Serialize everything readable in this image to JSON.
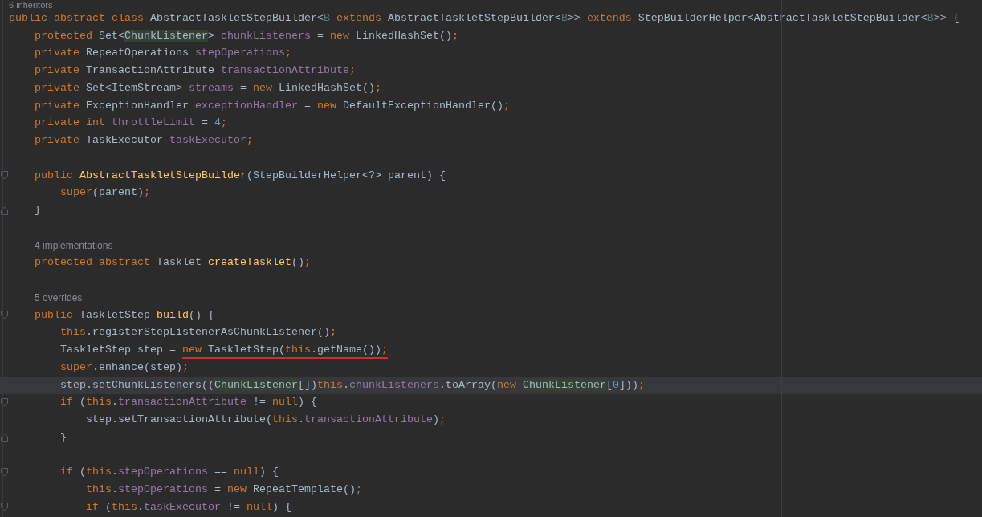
{
  "editor": {
    "lines": [
      {
        "kind": "hint",
        "text": "6 inheritors"
      },
      {
        "kind": "code",
        "tokens": [
          {
            "kind": "keyword",
            "text": "public abstract class "
          },
          {
            "kind": "plain",
            "text": "AbstractTaskletStepBuilder<"
          },
          {
            "kind": "type_param",
            "text": "B"
          },
          {
            "kind": "keyword",
            "text": " extends"
          },
          {
            "kind": "plain",
            "text": " AbstractTaskletStepBuilder<"
          },
          {
            "kind": "type_param",
            "text": "B"
          },
          {
            "kind": "plain",
            "text": ">> "
          },
          {
            "kind": "keyword",
            "text": "extends"
          },
          {
            "kind": "plain",
            "text": " StepBuilderHelper<AbstractTaskletStepBuilder<"
          },
          {
            "kind": "type_param",
            "text": "B"
          },
          {
            "kind": "plain",
            "text": ">> {"
          }
        ],
        "children": [
          {
            "kind": "code",
            "tokens": [
              {
                "kind": "keyword",
                "text": "protected "
              },
              {
                "kind": "plain",
                "text": "Set<"
              },
              {
                "kind": "usage",
                "text": "ChunkListener"
              },
              {
                "kind": "plain",
                "text": "> "
              },
              {
                "kind": "field",
                "text": "chunkListeners"
              },
              {
                "kind": "plain",
                "text": " = "
              },
              {
                "kind": "keyword",
                "text": "new "
              },
              {
                "kind": "plain",
                "text": "LinkedHashSet()"
              },
              {
                "kind": "keyword",
                "text": ";"
              }
            ]
          },
          {
            "kind": "code",
            "tokens": [
              {
                "kind": "keyword",
                "text": "private "
              },
              {
                "kind": "plain",
                "text": "RepeatOperations "
              },
              {
                "kind": "field",
                "text": "stepOperations"
              },
              {
                "kind": "keyword",
                "text": ";"
              }
            ]
          },
          {
            "kind": "code",
            "tokens": [
              {
                "kind": "keyword",
                "text": "private "
              },
              {
                "kind": "plain",
                "text": "TransactionAttribute "
              },
              {
                "kind": "field",
                "text": "transactionAttribute"
              },
              {
                "kind": "keyword",
                "text": ";"
              }
            ]
          },
          {
            "kind": "code",
            "tokens": [
              {
                "kind": "keyword",
                "text": "private "
              },
              {
                "kind": "plain",
                "text": "Set<ItemStream> "
              },
              {
                "kind": "field",
                "text": "streams"
              },
              {
                "kind": "plain",
                "text": " = "
              },
              {
                "kind": "keyword",
                "text": "new "
              },
              {
                "kind": "plain",
                "text": "LinkedHashSet()"
              },
              {
                "kind": "keyword",
                "text": ";"
              }
            ]
          },
          {
            "kind": "code",
            "tokens": [
              {
                "kind": "keyword",
                "text": "private "
              },
              {
                "kind": "plain",
                "text": "ExceptionHandler "
              },
              {
                "kind": "field",
                "text": "exceptionHandler"
              },
              {
                "kind": "plain",
                "text": " = "
              },
              {
                "kind": "keyword",
                "text": "new "
              },
              {
                "kind": "plain",
                "text": "DefaultExceptionHandler()"
              },
              {
                "kind": "keyword",
                "text": ";"
              }
            ]
          },
          {
            "kind": "code",
            "tokens": [
              {
                "kind": "keyword",
                "text": "private int "
              },
              {
                "kind": "field",
                "text": "throttleLimit"
              },
              {
                "kind": "plain",
                "text": " = "
              },
              {
                "kind": "number",
                "text": "4"
              },
              {
                "kind": "keyword",
                "text": ";"
              }
            ]
          },
          {
            "kind": "code",
            "tokens": [
              {
                "kind": "keyword",
                "text": "private "
              },
              {
                "kind": "plain",
                "text": "TaskExecutor "
              },
              {
                "kind": "field",
                "text": "taskExecutor"
              },
              {
                "kind": "keyword",
                "text": ";"
              }
            ]
          },
          {
            "kind": "blank"
          },
          {
            "kind": "code",
            "expanded": true,
            "tokens": [
              {
                "kind": "keyword",
                "text": "public "
              },
              {
                "kind": "declaration",
                "text": "AbstractTaskletStepBuilder"
              },
              {
                "kind": "plain",
                "text": "(StepBuilderHelper<?> parent) {"
              }
            ],
            "children": [
              {
                "kind": "code",
                "tokens": [
                  {
                    "kind": "keyword",
                    "text": "super"
                  },
                  {
                    "kind": "plain",
                    "text": "(parent)"
                  },
                  {
                    "kind": "keyword",
                    "text": ";"
                  }
                ]
              }
            ]
          },
          {
            "kind": "code",
            "block_end": true,
            "tokens": [
              {
                "kind": "plain",
                "text": "}"
              }
            ]
          },
          {
            "kind": "blank"
          },
          {
            "kind": "hint",
            "text": "4 implementations"
          },
          {
            "kind": "code",
            "tokens": [
              {
                "kind": "keyword",
                "text": "protected abstract "
              },
              {
                "kind": "plain",
                "text": "Tasklet "
              },
              {
                "kind": "declaration",
                "text": "createTasklet"
              },
              {
                "kind": "plain",
                "text": "()"
              },
              {
                "kind": "keyword",
                "text": ";"
              }
            ]
          },
          {
            "kind": "blank"
          },
          {
            "kind": "hint",
            "text": "5 overrides"
          },
          {
            "kind": "code",
            "expanded": true,
            "tokens": [
              {
                "kind": "keyword",
                "text": "public "
              },
              {
                "kind": "plain",
                "text": "TaskletStep "
              },
              {
                "kind": "declaration",
                "text": "build"
              },
              {
                "kind": "plain",
                "text": "() {"
              }
            ],
            "children": [
              {
                "kind": "code",
                "tokens": [
                  {
                    "kind": "keyword",
                    "text": "this"
                  },
                  {
                    "kind": "plain",
                    "text": ".registerStepListenerAsChunkListener()"
                  },
                  {
                    "kind": "keyword",
                    "text": ";"
                  }
                ]
              },
              {
                "kind": "code",
                "tokens": [
                  {
                    "kind": "plain",
                    "text": "TaskletStep step = "
                  }
                ],
                "underlined_tokens": [
                  {
                    "kind": "keyword",
                    "text": "new "
                  },
                  {
                    "kind": "plain",
                    "text": "TaskletStep("
                  },
                  {
                    "kind": "keyword",
                    "text": "this"
                  },
                  {
                    "kind": "plain",
                    "text": ".getName())"
                  },
                  {
                    "kind": "keyword",
                    "text": ";"
                  }
                ]
              },
              {
                "kind": "code",
                "tokens": [
                  {
                    "kind": "keyword",
                    "text": "super"
                  },
                  {
                    "kind": "plain",
                    "text": ".enhance(step)"
                  },
                  {
                    "kind": "keyword",
                    "text": ";"
                  }
                ]
              },
              {
                "kind": "code",
                "current": true,
                "tokens": [
                  {
                    "kind": "plain",
                    "text": "step.setChunkListeners(("
                  },
                  {
                    "kind": "usage",
                    "text": "ChunkListener"
                  },
                  {
                    "kind": "plain",
                    "text": "[])"
                  },
                  {
                    "kind": "keyword",
                    "text": "this"
                  },
                  {
                    "kind": "plain",
                    "text": "."
                  },
                  {
                    "kind": "field",
                    "text": "chunkListeners"
                  },
                  {
                    "kind": "plain",
                    "text": ".toArray("
                  },
                  {
                    "kind": "keyword",
                    "text": "new "
                  },
                  {
                    "kind": "usage",
                    "text": "ChunkListener"
                  },
                  {
                    "kind": "plain",
                    "text": "["
                  },
                  {
                    "kind": "number",
                    "text": "0"
                  },
                  {
                    "kind": "plain",
                    "text": "]))"
                  },
                  {
                    "kind": "keyword",
                    "text": ";"
                  }
                ]
              },
              {
                "kind": "code",
                "expanded": true,
                "tokens": [
                  {
                    "kind": "keyword",
                    "text": "if"
                  },
                  {
                    "kind": "plain",
                    "text": " ("
                  },
                  {
                    "kind": "keyword",
                    "text": "this"
                  },
                  {
                    "kind": "plain",
                    "text": "."
                  },
                  {
                    "kind": "field",
                    "text": "transactionAttribute"
                  },
                  {
                    "kind": "plain",
                    "text": " != "
                  },
                  {
                    "kind": "keyword",
                    "text": "null"
                  },
                  {
                    "kind": "plain",
                    "text": ") {"
                  }
                ],
                "children": [
                  {
                    "kind": "code",
                    "tokens": [
                      {
                        "kind": "plain",
                        "text": "step.setTransactionAttribute("
                      },
                      {
                        "kind": "keyword",
                        "text": "this"
                      },
                      {
                        "kind": "plain",
                        "text": "."
                      },
                      {
                        "kind": "field",
                        "text": "transactionAttribute"
                      },
                      {
                        "kind": "plain",
                        "text": ")"
                      },
                      {
                        "kind": "keyword",
                        "text": ";"
                      }
                    ]
                  }
                ]
              },
              {
                "kind": "code",
                "block_end": true,
                "tokens": [
                  {
                    "kind": "plain",
                    "text": "}"
                  }
                ]
              },
              {
                "kind": "blank"
              },
              {
                "kind": "code",
                "expanded": true,
                "tokens": [
                  {
                    "kind": "keyword",
                    "text": "if"
                  },
                  {
                    "kind": "plain",
                    "text": " ("
                  },
                  {
                    "kind": "keyword",
                    "text": "this"
                  },
                  {
                    "kind": "plain",
                    "text": "."
                  },
                  {
                    "kind": "field",
                    "text": "stepOperations"
                  },
                  {
                    "kind": "plain",
                    "text": " == "
                  },
                  {
                    "kind": "keyword",
                    "text": "null"
                  },
                  {
                    "kind": "plain",
                    "text": ") {"
                  }
                ],
                "children": [
                  {
                    "kind": "code",
                    "tokens": [
                      {
                        "kind": "keyword",
                        "text": "this"
                      },
                      {
                        "kind": "plain",
                        "text": "."
                      },
                      {
                        "kind": "field",
                        "text": "stepOperations"
                      },
                      {
                        "kind": "plain",
                        "text": " = "
                      },
                      {
                        "kind": "keyword",
                        "text": "new "
                      },
                      {
                        "kind": "plain",
                        "text": "RepeatTemplate()"
                      },
                      {
                        "kind": "keyword",
                        "text": ";"
                      }
                    ]
                  },
                  {
                    "kind": "code",
                    "expanded": true,
                    "tokens": [
                      {
                        "kind": "keyword",
                        "text": "if"
                      },
                      {
                        "kind": "plain",
                        "text": " ("
                      },
                      {
                        "kind": "keyword",
                        "text": "this"
                      },
                      {
                        "kind": "plain",
                        "text": "."
                      },
                      {
                        "kind": "field",
                        "text": "taskExecutor"
                      },
                      {
                        "kind": "plain",
                        "text": " != "
                      },
                      {
                        "kind": "keyword",
                        "text": "null"
                      },
                      {
                        "kind": "plain",
                        "text": ") {"
                      }
                    ]
                  }
                ]
              }
            ]
          }
        ]
      }
    ]
  }
}
